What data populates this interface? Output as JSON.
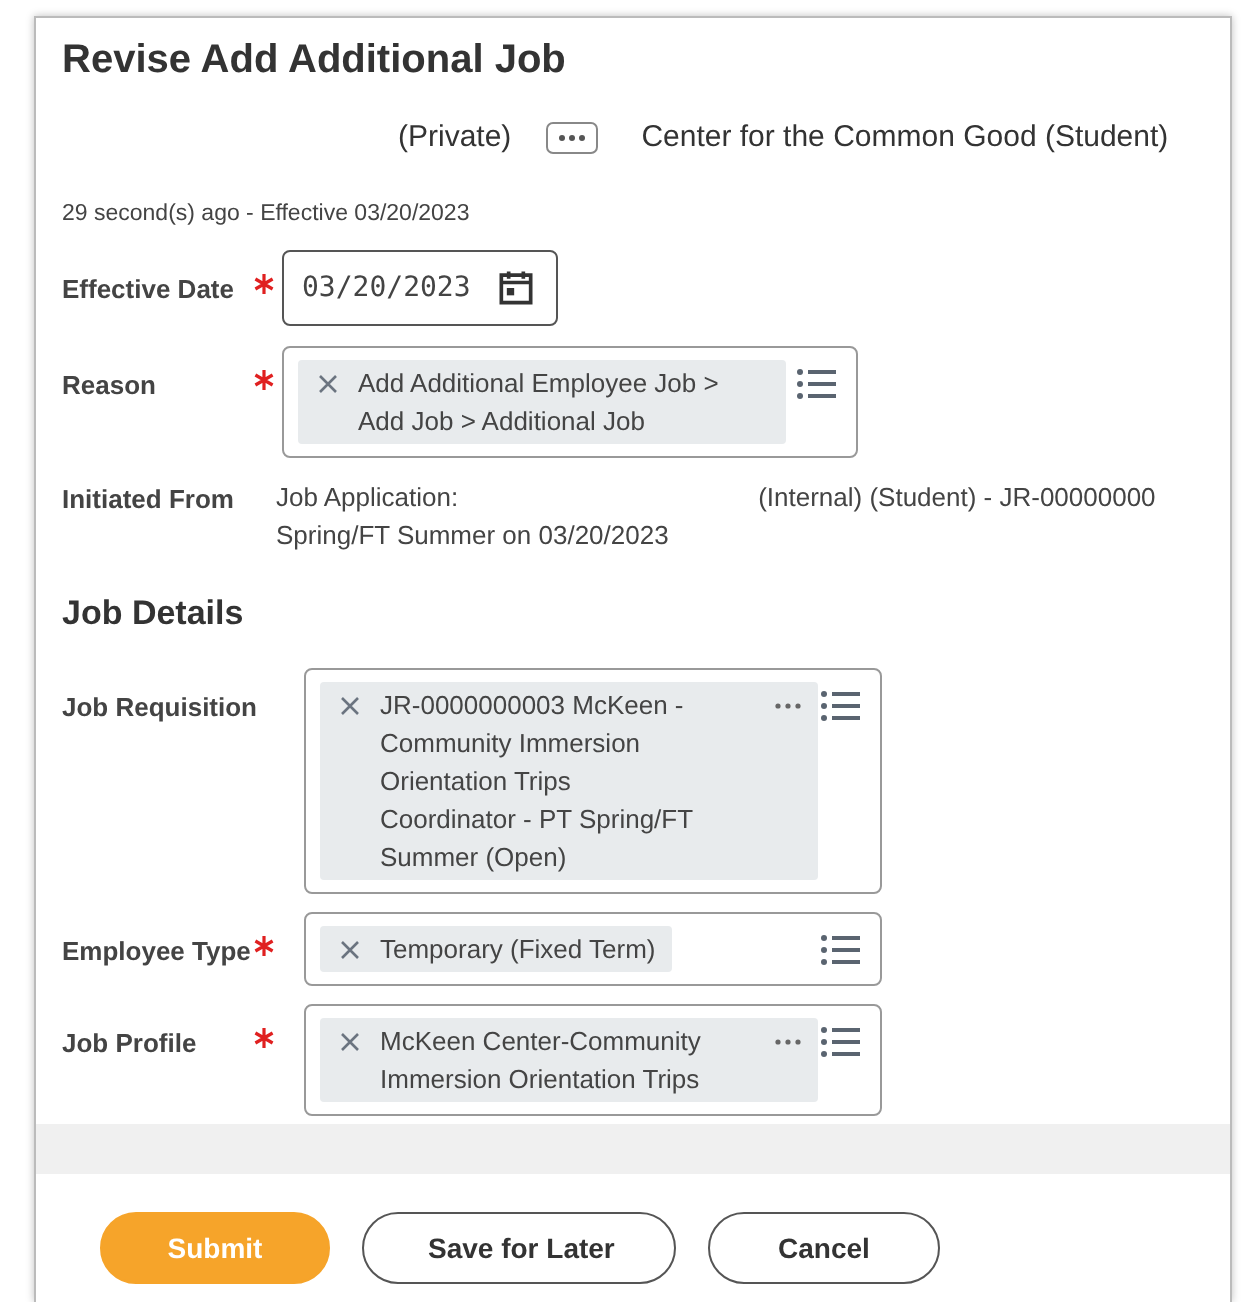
{
  "title": "Revise Add Additional Job",
  "subject": {
    "privacy": "(Private)",
    "organization": "Center for the Common Good (Student)"
  },
  "timestamp": "29 second(s) ago -  Effective 03/20/2023",
  "top_fields": [
    {
      "label": "Effective Date",
      "required": true,
      "kind": "date",
      "value": "03/20/2023"
    },
    {
      "label": "Reason",
      "required": true,
      "kind": "prompt",
      "chips": [
        {
          "text": "Add Additional Employee Job > Add Job > Additional Job",
          "more": false
        }
      ]
    },
    {
      "label": "Initiated From",
      "required": false,
      "kind": "text",
      "lines": [
        [
          "Job Application:",
          "(Internal) (Student) - JR-00000000"
        ],
        [
          "Spring/FT Summer on 03/20/2023"
        ]
      ]
    }
  ],
  "section": {
    "title": "Job Details",
    "fields": [
      {
        "label": "Job Requisition",
        "required": false,
        "kind": "prompt",
        "chips": [
          {
            "text": "JR-0000000003 McKeen - Community Immersion Orientation Trips Coordinator - PT Spring/FT Summer (Open)",
            "more": true
          }
        ]
      },
      {
        "label": "Employee Type",
        "required": true,
        "kind": "prompt",
        "chips": [
          {
            "text": "Temporary (Fixed Term)",
            "more": false
          }
        ]
      },
      {
        "label": "Job Profile",
        "required": true,
        "kind": "prompt",
        "chips": [
          {
            "text": "McKeen Center-Community Immersion Orientation Trips",
            "more": true
          }
        ]
      }
    ]
  },
  "buttons": [
    {
      "label": "Submit",
      "kind": "primary"
    },
    {
      "label": "Save for Later",
      "kind": "secondary"
    },
    {
      "label": "Cancel",
      "kind": "secondary"
    }
  ]
}
